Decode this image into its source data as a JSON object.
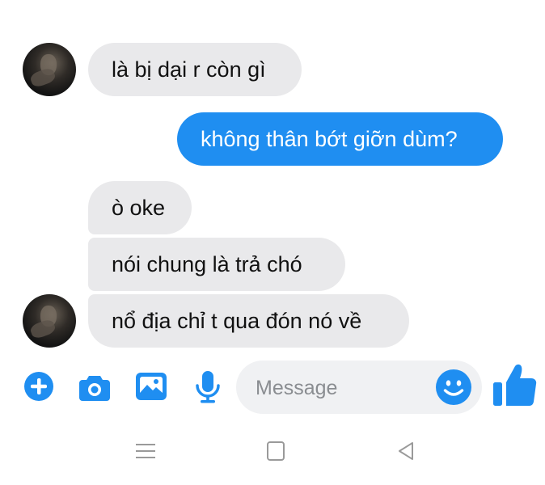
{
  "conversation": {
    "messages": [
      {
        "direction": "incoming",
        "text": "là bị dại r còn gì"
      },
      {
        "direction": "outgoing",
        "text": "không thân bớt giỡn dùm?"
      },
      {
        "direction": "incoming",
        "text": "ò oke"
      },
      {
        "direction": "incoming",
        "text": "nói chung là trả chó"
      },
      {
        "direction": "incoming",
        "text": "nổ địa chỉ t qua đón nó về"
      }
    ]
  },
  "composer": {
    "placeholder": "Message",
    "value": ""
  },
  "toolbar": {
    "icons": [
      "plus-icon",
      "camera-icon",
      "gallery-icon",
      "microphone-icon",
      "emoji-icon",
      "thumbs-up-icon"
    ]
  },
  "navbar": {
    "icons": [
      "menu-icon",
      "home-square-icon",
      "back-triangle-icon"
    ]
  },
  "colors": {
    "accent": "#1f8ef1",
    "incoming_bubble": "#e9e9eb",
    "composer_bg": "#f0f1f3",
    "navbar_icon": "#9a9a9a"
  }
}
